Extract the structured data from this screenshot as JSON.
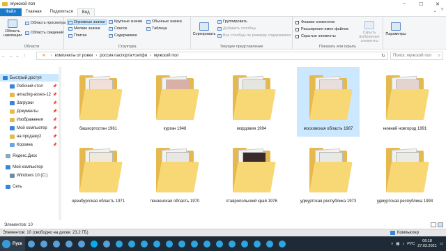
{
  "window": {
    "title": "мужской пол"
  },
  "ribbon_tabs": [
    "Файл",
    "Главная",
    "Поделиться",
    "Вид"
  ],
  "ribbon": {
    "pane_group": {
      "label": "Области",
      "nav_pane": "Область навигации",
      "preview": "Область просмотра",
      "details": "Область сведений"
    },
    "layout_group": {
      "label": "Структура",
      "items": [
        "Огромные значки",
        "Крупные значки",
        "Обычные значки",
        "Мелкие значки",
        "Список",
        "Таблица",
        "Плитка",
        "Содержимое"
      ]
    },
    "current_view_group": {
      "label": "Текущее представление",
      "sort": "Сортировать",
      "group_by": "Группировать",
      "add_columns": "Добавить столбцы",
      "fit_columns": "Все столбцы по размеру содержимого"
    },
    "show_hide_group": {
      "label": "Показать или скрыть",
      "checkboxes": [
        "Флажки элементов",
        "Расширения имен файлов",
        "Скрытые элементы"
      ],
      "hide_selected": "Скрыть выбранные элементы"
    },
    "options": "Параметры"
  },
  "address": {
    "path": [
      "комплекты от рокки",
      "россия паспорта+селфи",
      "мужской пол"
    ],
    "search_placeholder": "Поиск: мужской пол"
  },
  "nav": [
    {
      "label": "Быстрый доступ",
      "icon": "star-icon",
      "color": "#2f7fd8",
      "pinned": false,
      "selected": true
    },
    {
      "label": "Рабочий стол",
      "icon": "folder-icon",
      "color": "#3a86d6",
      "pinned": true
    },
    {
      "label": "amazing-asses-12",
      "icon": "folder-icon",
      "color": "#e5b94e",
      "pinned": true
    },
    {
      "label": "Загрузки",
      "icon": "download-icon",
      "color": "#3a86d6",
      "pinned": true
    },
    {
      "label": "Документы",
      "icon": "folder-icon",
      "color": "#e5b94e",
      "pinned": true
    },
    {
      "label": "Изображения",
      "icon": "folder-icon",
      "color": "#e5b94e",
      "pinned": true
    },
    {
      "label": "Мой компьютер",
      "icon": "computer-icon",
      "color": "#3a86d6",
      "pinned": true
    },
    {
      "label": "на продажу2",
      "icon": "folder-icon",
      "color": "#e5b94e",
      "pinned": true
    },
    {
      "label": "Корзина",
      "icon": "recycle-bin-icon",
      "color": "#6aa6e0",
      "pinned": true
    },
    {
      "label": "Яндекс.Диск",
      "icon": "cloud-icon",
      "color": "#8aa7c4",
      "pinned": false
    },
    {
      "label": "Мой компьютер",
      "icon": "computer-icon",
      "color": "#3a86d6",
      "pinned": false
    },
    {
      "label": "Windows 10 (C:)",
      "icon": "drive-icon",
      "color": "#6f8aa6",
      "pinned": false
    },
    {
      "label": "Сеть",
      "icon": "network-icon",
      "color": "#3a86d6",
      "pinned": false
    }
  ],
  "folders": [
    {
      "name": "башкортостан 1961",
      "selected": false
    },
    {
      "name": "курган 1948",
      "selected": false
    },
    {
      "name": "мордовия 1994",
      "selected": false
    },
    {
      "name": "московская область 1987",
      "selected": true
    },
    {
      "name": "нижний новгород 1991",
      "selected": false
    },
    {
      "name": "оренбургская область 1971",
      "selected": false
    },
    {
      "name": "пензенская область 1970",
      "selected": false
    },
    {
      "name": "ставропольский край 1976",
      "selected": false
    },
    {
      "name": "удмуртская республика 1973",
      "selected": false
    },
    {
      "name": "удмуртская республика 1993",
      "selected": false
    }
  ],
  "status": {
    "count": "Элементов: 10"
  },
  "info_strip": {
    "left": "Элементов: 10 (свободно на диске: 23,2 ГБ)",
    "right": "Компьютер"
  },
  "taskbar": {
    "start": "Пуск",
    "icons": [
      "app-icon",
      "app-icon",
      "app-icon",
      "app-icon",
      "app-icon",
      "skype-icon",
      "app-icon",
      "telegram-icon",
      "telegram-icon",
      "telegram-icon",
      "telegram-icon",
      "telegram-icon",
      "telegram-icon",
      "telegram-icon",
      "telegram-icon",
      "telegram-icon",
      "telegram-icon",
      "telegram-icon",
      "telegram-icon",
      "telegram-icon",
      "telegram-icon"
    ],
    "lang": "РУС",
    "time": "06:18",
    "date": "27.02.2021"
  }
}
